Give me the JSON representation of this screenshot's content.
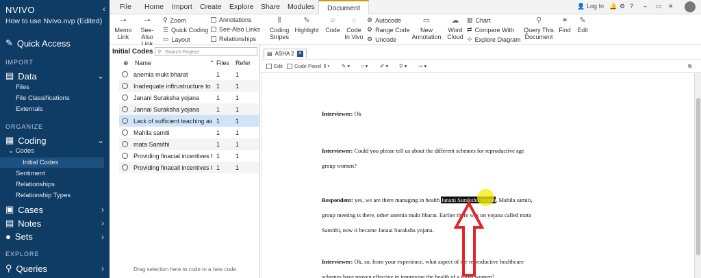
{
  "app": {
    "logo": "NVIVO",
    "project": "How to use Nvivo.nvp (Edited)"
  },
  "nav": {
    "quick_access": "Quick Access",
    "import_label": "IMPORT",
    "data": "Data",
    "data_items": [
      "Files",
      "File Classifications",
      "Externals"
    ],
    "organize_label": "ORGANIZE",
    "coding": "Coding",
    "codes": "Codes",
    "initial_codes": "Initial Codes",
    "coding_items": [
      "Sentiment",
      "Relationships",
      "Relationship Types"
    ],
    "cases": "Cases",
    "notes": "Notes",
    "sets": "Sets",
    "explore_label": "EXPLORE",
    "queries": "Queries"
  },
  "ribbon": {
    "tabs": [
      "File",
      "Home",
      "Import",
      "Create",
      "Explore",
      "Share",
      "Modules",
      "Document"
    ],
    "active_tab": "Document",
    "login": "Log In",
    "buttons": {
      "memo_link": [
        "Memo",
        "Link"
      ],
      "see_also_link": [
        "See-Also",
        "Link"
      ],
      "zoom": "Zoom",
      "quick_coding": "Quick Coding",
      "layout": "Layout",
      "annotations": "Annotations",
      "see_also_links": "See-Also Links",
      "relationships": "Relationships",
      "coding_stripes": [
        "Coding",
        "Stripes"
      ],
      "highlight": "Highlight",
      "code": "Code",
      "code_in_vivo": [
        "Code",
        "In Vivo"
      ],
      "autocode": "Autocode",
      "range_code": "Range Code",
      "uncode": "Uncode",
      "new_annotation": [
        "New",
        "Annotation"
      ],
      "word_cloud": [
        "Word",
        "Cloud"
      ],
      "chart": "Chart",
      "compare_with": "Compare With",
      "explore_diagram": "Explore Diagram",
      "query_this_document": [
        "Query This",
        "Document"
      ],
      "find": "Find",
      "edit": "Edit"
    }
  },
  "codes_panel": {
    "title": "Initial Codes",
    "search_placeholder": "Search Project",
    "col_name": "Name",
    "col_files": "Files",
    "col_refs": "Refer",
    "rows": [
      {
        "name": "anemia mukt bharat",
        "files": "1",
        "refs": "1"
      },
      {
        "name": "Inadequate inftrustructure to c",
        "files": "1",
        "refs": "1"
      },
      {
        "name": "Janani Suraksha yojana",
        "files": "1",
        "refs": "1"
      },
      {
        "name": "Jannai Suraksha yojana",
        "files": "1",
        "refs": "1"
      },
      {
        "name": "Lack of sufficient  teaching aid",
        "files": "1",
        "refs": "1"
      },
      {
        "name": "Mahila samiti",
        "files": "1",
        "refs": "1"
      },
      {
        "name": "mata Samithi",
        "files": "1",
        "refs": "1"
      },
      {
        "name": "Providing  finacial incentives fo",
        "files": "1",
        "refs": "1"
      },
      {
        "name": "Providing finacail incentives to",
        "files": "1",
        "refs": "1"
      }
    ],
    "drag_hint": "Drag selection here to code to a new code"
  },
  "document": {
    "tab_name": "ASHA 2",
    "toolbar": {
      "edit": "Edit",
      "code_panel": "Code Panel"
    },
    "paragraphs": [
      {
        "speaker": "Interviewer:",
        "text": " Ok"
      },
      {
        "speaker": "Interviewer:",
        "text": " Could you please tell us about the different schemes for reproductive age group women?"
      },
      {
        "speaker": "Respondent:",
        "pre": " yes, we are there managing in health ",
        "highlight": "Janani Suraksha yojana",
        "post": ", Mahila samiti, group meeting is there, other anemia mukt bharat. Earlier there was on yojana called mata Samithi, now it became Janaai Suraksha yojana."
      },
      {
        "speaker": "Interviewer:",
        "text": " Ok, so, from your experience, what aspect of the reproductive healthcare schemes have proven effective in improving the health of a tribal women?"
      }
    ]
  },
  "colors": {
    "nav_bg": "#0f3c64",
    "selection": "#cfe4f8",
    "annotation_arrow": "#e0252b",
    "cursor_highlight": "#f6ee00"
  }
}
